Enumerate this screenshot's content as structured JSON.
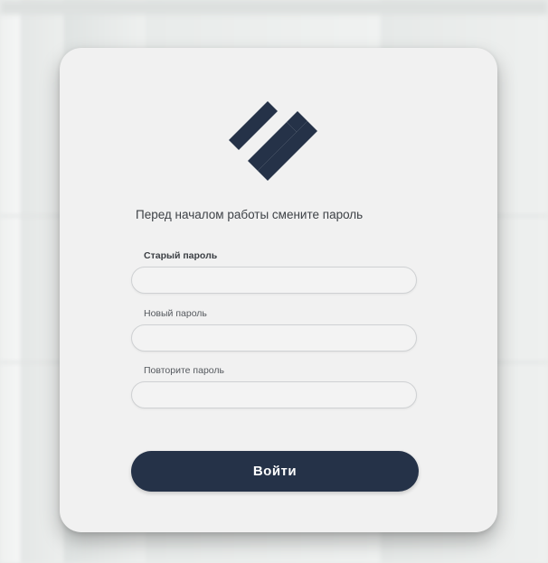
{
  "modal": {
    "subtitle": "Перед началом работы смените пароль",
    "fields": [
      {
        "label": "Старый пароль",
        "value": "",
        "placeholder": ""
      },
      {
        "label": "Новый пароль",
        "value": "",
        "placeholder": ""
      },
      {
        "label": "Повторите пароль",
        "value": "",
        "placeholder": ""
      }
    ],
    "submit_label": "Войти"
  },
  "icons": {
    "logo": "logo-icon"
  },
  "colors": {
    "brand": "#253248",
    "card_background": "#f1f1f1",
    "page_background": "#e9ebea"
  }
}
